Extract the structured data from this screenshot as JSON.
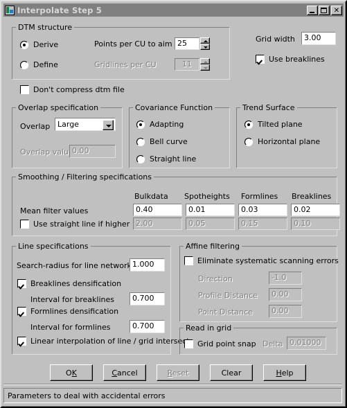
{
  "window": {
    "title": "Interpolate Step 5",
    "icon": "app-icon",
    "controls": {
      "minimize": "_",
      "maximize": "□",
      "close": "✕"
    }
  },
  "dtm_structure": {
    "legend": "DTM structure",
    "derive_label": "Derive",
    "derive_selected": true,
    "define_label": "Define",
    "define_selected": false,
    "points_per_cu_label": "Points per CU to aim at",
    "points_per_cu_value": "25",
    "gridlines_per_cu_label": "Gridlines per CU",
    "gridlines_per_cu_value": "11"
  },
  "grid_width": {
    "label": "Grid width",
    "value": "3.00"
  },
  "use_breaklines": {
    "label": "Use breaklines",
    "checked": true
  },
  "dont_compress": {
    "label": "Don't compress dtm file",
    "checked": false
  },
  "overlap": {
    "legend": "Overlap specification",
    "overlap_label": "Overlap",
    "overlap_value": "Large",
    "overlap_value_label": "Overlap value",
    "overlap_value_field": "0.00"
  },
  "covariance": {
    "legend": "Covariance Function",
    "options": [
      {
        "label": "Adapting",
        "selected": true
      },
      {
        "label": "Bell curve",
        "selected": false
      },
      {
        "label": "Straight line",
        "selected": false
      }
    ]
  },
  "trend_surface": {
    "legend": "Trend Surface",
    "options": [
      {
        "label": "Tilted plane",
        "selected": true
      },
      {
        "label": "Horizontal plane",
        "selected": false
      }
    ]
  },
  "smoothing": {
    "legend": "Smoothing / Filtering specifications",
    "columns": [
      "Bulkdata",
      "Spotheights",
      "Formlines",
      "Breaklines"
    ],
    "mean_filter_label": "Mean filter values",
    "mean_filter_values": [
      "0.40",
      "0.01",
      "0.03",
      "0.02"
    ],
    "straight_line_label": "Use straight line if higher thar",
    "straight_line_checked": false,
    "straight_line_values": [
      "2.00",
      "0.05",
      "0.15",
      "0.10"
    ]
  },
  "line_specs": {
    "legend": "Line specifications",
    "search_radius_label": "Search-radius for line networking",
    "search_radius_value": "1.000",
    "breaklines_densification_label": "Breaklines densification",
    "breaklines_densification_checked": true,
    "interval_breaklines_label": "Interval for breaklines",
    "interval_breaklines_value": "0.700",
    "formlines_densification_label": "Formlines densification",
    "formlines_densification_checked": true,
    "interval_formlines_label": "Interval for formlines",
    "interval_formlines_value": "0.700",
    "linear_interp_label": "Linear interpolation of line / grid intersect",
    "linear_interp_checked": true
  },
  "affine": {
    "legend": "Affine filtering",
    "eliminate_label": "Eliminate systematic scanning errors",
    "eliminate_checked": false,
    "direction_label": "Direction",
    "direction_value": "-1.0",
    "profile_distance_label": "Profile Distance",
    "profile_distance_value": "0.00",
    "point_distance_label": "Point Distance",
    "point_distance_value": "0.00"
  },
  "read_in_grid": {
    "legend": "Read in grid",
    "grid_point_snap_label": "Grid point snap",
    "grid_point_snap_checked": false,
    "delta_label": "Delta",
    "delta_value": "0.01000"
  },
  "buttons": [
    {
      "pre": "O",
      "acc": "K",
      "post": "",
      "disabled": false,
      "name": "ok-button"
    },
    {
      "pre": "",
      "acc": "C",
      "post": "ancel",
      "disabled": false,
      "name": "cancel-button"
    },
    {
      "pre": "",
      "acc": "R",
      "post": "eset",
      "disabled": true,
      "name": "reset-button"
    },
    {
      "pre": "Clear",
      "acc": "",
      "post": "",
      "disabled": false,
      "name": "clear-button"
    },
    {
      "pre": "",
      "acc": "H",
      "post": "elp",
      "disabled": false,
      "name": "help-button"
    }
  ],
  "statusbar": {
    "text": "Parameters to deal with accidental errors"
  }
}
